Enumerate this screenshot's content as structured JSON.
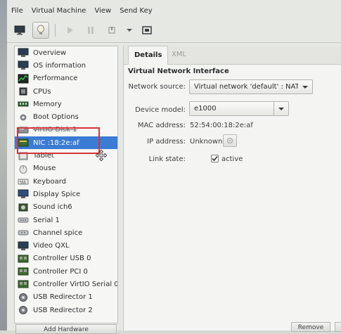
{
  "menubar": {
    "items": [
      "File",
      "Virtual Machine",
      "View",
      "Send Key"
    ]
  },
  "toolbar": {
    "icons": [
      "monitor-icon",
      "lightbulb-icon",
      "play-icon",
      "pause-icon",
      "power-icon",
      "dropdown-arrow-icon",
      "fullscreen-icon"
    ]
  },
  "sidebar": {
    "items": [
      {
        "label": "Overview",
        "icon": "monitor-icon"
      },
      {
        "label": "OS information",
        "icon": "monitor-icon"
      },
      {
        "label": "Performance",
        "icon": "performance-icon"
      },
      {
        "label": "CPUs",
        "icon": "cpu-icon"
      },
      {
        "label": "Memory",
        "icon": "memory-icon"
      },
      {
        "label": "Boot Options",
        "icon": "gear-icon"
      },
      {
        "label": "VirtIO Disk 1",
        "icon": "disk-icon"
      },
      {
        "label": "NIC :18:2e:af",
        "icon": "network-icon"
      },
      {
        "label": "Tablet",
        "icon": "tablet-icon"
      },
      {
        "label": "Mouse",
        "icon": "mouse-icon"
      },
      {
        "label": "Keyboard",
        "icon": "keyboard-icon"
      },
      {
        "label": "Display Spice",
        "icon": "display-icon"
      },
      {
        "label": "Sound ich6",
        "icon": "sound-icon"
      },
      {
        "label": "Serial 1",
        "icon": "serial-icon"
      },
      {
        "label": "Channel spice",
        "icon": "channel-icon"
      },
      {
        "label": "Video QXL",
        "icon": "video-icon"
      },
      {
        "label": "Controller USB 0",
        "icon": "controller-icon"
      },
      {
        "label": "Controller PCI 0",
        "icon": "controller-icon"
      },
      {
        "label": "Controller VirtIO Serial 0",
        "icon": "controller-icon"
      },
      {
        "label": "USB Redirector 1",
        "icon": "usb-redirector-icon"
      },
      {
        "label": "USB Redirector 2",
        "icon": "usb-redirector-icon"
      }
    ],
    "selected_index": 7,
    "add_hardware_label": "Add Hardware"
  },
  "details": {
    "tabs": [
      "Details",
      "XML"
    ],
    "active_tab": "Details",
    "section_title": "Virtual Network Interface",
    "network_source_label": "Network source:",
    "network_source_value": "Virtual network 'default' : NAT",
    "device_model_label": "Device model:",
    "device_model_value": "e1000",
    "mac_label": "MAC address:",
    "mac_value": "52:54:00:18:2e:af",
    "ip_label": "IP address:",
    "ip_value": "Unknown",
    "link_state_label": "Link state:",
    "link_state_value": "active",
    "link_state_checked": true,
    "remove_label": "Remove"
  },
  "colors": {
    "selection": "#3a7bd5",
    "highlight_box": "#d8343a"
  }
}
